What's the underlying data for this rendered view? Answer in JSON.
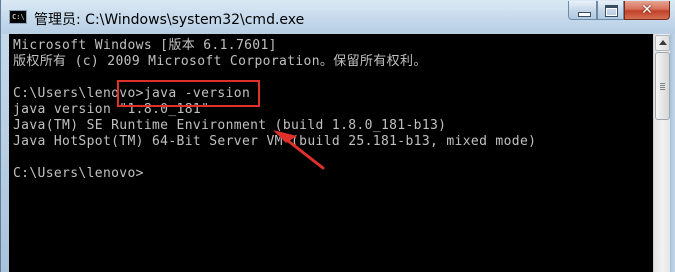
{
  "window": {
    "title": "管理员: C:\\Windows\\system32\\cmd.exe",
    "icon_label": "C:\\",
    "controls": {
      "minimize": "minimize-icon",
      "maximize": "maximize-icon",
      "close": "close-icon",
      "close_label": "✕"
    }
  },
  "console": {
    "lines": [
      "Microsoft Windows [版本 6.1.7601]",
      "版权所有 (c) 2009 Microsoft Corporation。保留所有权利。",
      "",
      "C:\\Users\\lenovo>java -version",
      "java version \"1.8.0_181\"",
      "Java(TM) SE Runtime Environment (build 1.8.0_181-b13)",
      "Java HotSpot(TM) 64-Bit Server VM (build 25.181-b13, mixed mode)",
      "",
      "C:\\Users\\lenovo>"
    ]
  },
  "annotations": {
    "highlight_color": "#e0302a",
    "arrow_color": "#e0302a"
  },
  "colors": {
    "console_bg": "#000000",
    "console_text": "#c0c0c0"
  }
}
